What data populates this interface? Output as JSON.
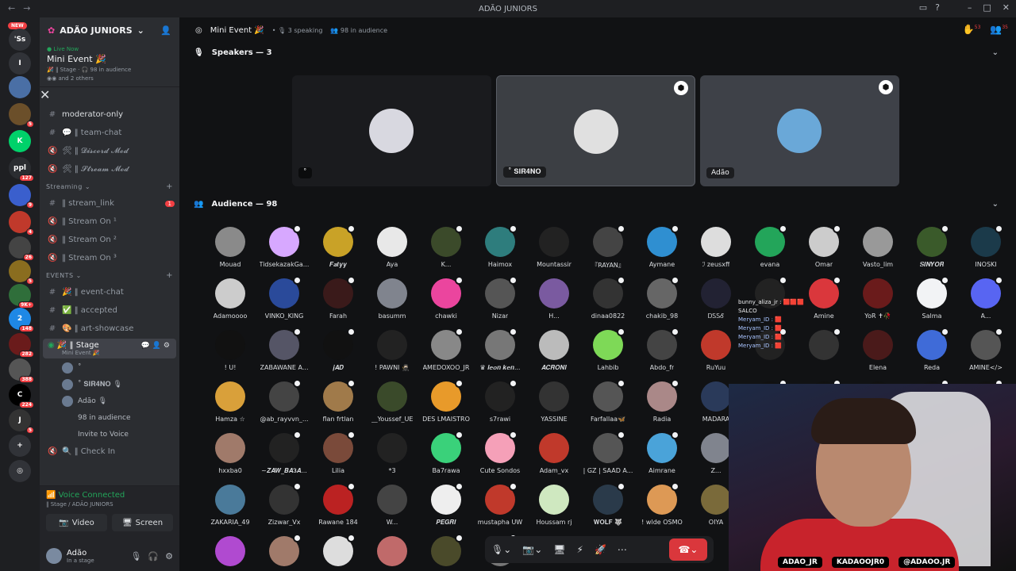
{
  "titlebar": {
    "title": "ADÃO JUNIORS"
  },
  "rail": {
    "new_badge": "NEW",
    "servers": [
      {
        "label": "'Ss",
        "color": "#313338",
        "count": ""
      },
      {
        "label": "I",
        "color": "#313338",
        "count": ""
      },
      {
        "label": "",
        "color": "#4a6fa5",
        "count": ""
      },
      {
        "label": "",
        "color": "#6b4f2a",
        "count": "5"
      },
      {
        "label": "K",
        "color": "#00d26a",
        "count": ""
      },
      {
        "label": "ppl",
        "color": "#2b2d31",
        "count": "127"
      },
      {
        "label": "",
        "color": "#3a5fcd",
        "count": "9"
      },
      {
        "label": "",
        "color": "#c0392b",
        "count": "4"
      },
      {
        "label": "",
        "color": "#444",
        "count": "26"
      },
      {
        "label": "",
        "color": "#8a6d1f",
        "count": "5"
      },
      {
        "label": "",
        "color": "#2f6e3a",
        "count": "9K+"
      },
      {
        "label": "2",
        "color": "#1e88e5",
        "count": "148"
      },
      {
        "label": "",
        "color": "#6a1b1b",
        "count": "282"
      },
      {
        "label": "",
        "color": "#555",
        "count": "388"
      },
      {
        "label": "C",
        "color": "#000",
        "count": "224"
      },
      {
        "label": "J",
        "color": "#333",
        "count": "5"
      },
      {
        "label": "+",
        "color": "#313338",
        "count": ""
      },
      {
        "label": "◎",
        "color": "#313338",
        "count": ""
      }
    ]
  },
  "sidebar": {
    "guild_name": "ADÃO JUNIORS",
    "live": {
      "tag": "Live Now",
      "title": "Mini Event 🎉",
      "meta": "🎉 ‖ Stage · 🎧 98 in audience",
      "others": "and 2 others"
    },
    "channels_top": [
      {
        "name": "moderator-only",
        "prefix": "#",
        "bright": true
      },
      {
        "name": "💬 ‖ team-chat",
        "prefix": "#",
        "bright": false
      },
      {
        "name": "🛠 ‖ 𝓓𝓲𝓼𝓬𝓸𝓻𝓭 𝓜𝓸𝓭",
        "prefix": "🔇",
        "bright": false
      },
      {
        "name": "🛠 ‖ 𝓢𝓽𝓻𝓮𝓪𝓶 𝓜𝓸𝓭",
        "prefix": "🔇",
        "bright": false
      }
    ],
    "cat_streaming": "Streaming",
    "channels_streaming": [
      {
        "name": "‖ stream_link",
        "prefix": "#",
        "badge": "1"
      },
      {
        "name": "‖ Stream On ¹",
        "prefix": "🔇",
        "badge": ""
      },
      {
        "name": "‖ Stream On ²",
        "prefix": "🔇",
        "badge": ""
      },
      {
        "name": "‖ Stream On ³",
        "prefix": "🔇",
        "badge": ""
      }
    ],
    "cat_events": "EVENTS",
    "channels_events": [
      {
        "name": "🎉 ‖ event-chat",
        "prefix": "#"
      },
      {
        "name": "✅ ‖ accepted",
        "prefix": "#"
      },
      {
        "name": "🎨 ‖ art-showcase",
        "prefix": "#"
      }
    ],
    "stage": {
      "name": "🎉 ‖ Stage",
      "sub": "Mini Event 🎉"
    },
    "members": [
      {
        "name": "˚"
      },
      {
        "name": "˚ 𝐒𝐈𝐑𝟒𝐍𝐎  🎙"
      },
      {
        "name": "Adão  🎙"
      },
      {
        "name": "98 in audience"
      },
      {
        "name": "Invite to Voice"
      }
    ],
    "check_in": "🔍 ‖ Check In",
    "voice": {
      "status": "Voice Connected",
      "location": "‖ Stage / ADÃO JUNIORS",
      "video_label": "Video",
      "screen_label": "Screen"
    },
    "user": {
      "name": "Adão",
      "status": "In a stage"
    }
  },
  "main": {
    "topbar": {
      "title": "Mini Event 🎉",
      "speaking": "3 speaking",
      "audience": "98 in audience",
      "inbox_count": "53",
      "notif_count": "35"
    },
    "speakers_header": "Speakers — 3",
    "speakers": [
      {
        "label": "˚",
        "bg": "#1a1b1e"
      },
      {
        "label": "˚ 𝐒𝐈𝐑𝟒𝐍𝐎",
        "bg": "#3c3f44"
      },
      {
        "label": "Adão",
        "bg": "#3e4148"
      }
    ],
    "audience_header": "Audience — 98",
    "audience": [
      {
        "name": "Mouad",
        "c": "#8a8a8a"
      },
      {
        "name": "TidsekazakGa...",
        "c": "#d7a8ff"
      },
      {
        "name": "𝑭𝒂𝒕𝒚𝒚",
        "c": "#c9a227"
      },
      {
        "name": "Aya",
        "c": "#e8e8e8"
      },
      {
        "name": "K...",
        "c": "#3b4a2a"
      },
      {
        "name": "Haimox",
        "c": "#2e7d7d"
      },
      {
        "name": "Mountassir",
        "c": "#222"
      },
      {
        "name": "『RAYAN』",
        "c": "#444"
      },
      {
        "name": "Aymane",
        "c": "#2f8fd1"
      },
      {
        "name": "ℐ zeusxff",
        "c": "#ddd"
      },
      {
        "name": "evana",
        "c": "#23a55a"
      },
      {
        "name": "Omar",
        "c": "#ccc"
      },
      {
        "name": "Vasto_lim",
        "c": "#999"
      },
      {
        "name": "𝑺𝑰𝑵𝒀𝑶𝑹",
        "c": "#3a5a2a"
      },
      {
        "name": "INOSKI",
        "c": "#1b3a4a"
      },
      {
        "name": "Adamoooo",
        "c": "#ccc"
      },
      {
        "name": "VINKO_KING",
        "c": "#2a4a9a"
      },
      {
        "name": "Farah",
        "c": "#3a1a1a"
      },
      {
        "name": "basumm",
        "c": "#80848e"
      },
      {
        "name": "chawki",
        "c": "#eb459e"
      },
      {
        "name": "Nizar",
        "c": "#555"
      },
      {
        "name": "H...",
        "c": "#7a5aa0"
      },
      {
        "name": "dinaa0822",
        "c": "#333"
      },
      {
        "name": "chakib_98",
        "c": "#666"
      },
      {
        "name": "ᎠᏚᏚᎴ",
        "c": "#223"
      },
      {
        "name": "",
        "c": "#222"
      },
      {
        "name": "Amine",
        "c": "#da373c"
      },
      {
        "name": "YoR ✝🥀",
        "c": "#6a1b1b"
      },
      {
        "name": "Salma",
        "c": "#f2f3f5"
      },
      {
        "name": "A...",
        "c": "#5865f2"
      },
      {
        "name": "! U!",
        "c": "#111"
      },
      {
        "name": "ZABAWANE A...",
        "c": "#556"
      },
      {
        "name": "𝒋𝑨𝑫",
        "c": "#111"
      },
      {
        "name": "! PAWNI 🥷🏻",
        "c": "#222"
      },
      {
        "name": "AMEDOXOO_JR",
        "c": "#888"
      },
      {
        "name": "♛ 𝒍𝒆𝒐𝒏 𝒌𝒆𝒏...",
        "c": "#777"
      },
      {
        "name": "𝑨𝑪𝑹𝑶𝑵𝑰",
        "c": "#bbb"
      },
      {
        "name": "Lahbib",
        "c": "#7ed957"
      },
      {
        "name": "Abdo_fr",
        "c": "#444"
      },
      {
        "name": "RuYuu",
        "c": "#c0392b"
      },
      {
        "name": "",
        "c": "#222"
      },
      {
        "name": "",
        "c": "#333"
      },
      {
        "name": "Elena",
        "c": "#4a1a1a"
      },
      {
        "name": "Reda",
        "c": "#3f6bd8"
      },
      {
        "name": "AMINE</>",
        "c": "#555"
      },
      {
        "name": "Hamza ☆",
        "c": "#d9a03a"
      },
      {
        "name": "@ab_rayvvn_...",
        "c": "#444"
      },
      {
        "name": "flan frtlan",
        "c": "#a07a4a"
      },
      {
        "name": "__Youssef_UE",
        "c": "#3a4a2a"
      },
      {
        "name": "DES LMAISTRO",
        "c": "#e89a2a"
      },
      {
        "name": "s7rawi",
        "c": "#222"
      },
      {
        "name": "YASSINE",
        "c": "#333"
      },
      {
        "name": "Farfallaa🦋",
        "c": "#555"
      },
      {
        "name": "Radia",
        "c": "#a88"
      },
      {
        "name": "MADARA",
        "c": "#2a3a5a"
      },
      {
        "name": "",
        "c": "#111"
      },
      {
        "name": "",
        "c": "#111"
      },
      {
        "name": "",
        "c": "#111"
      },
      {
        "name": "",
        "c": "#111"
      },
      {
        "name": "",
        "c": "#111"
      },
      {
        "name": "hxxba0",
        "c": "#a07a6a"
      },
      {
        "name": "~𝒁𝑨𝑾_𝑩𝑨𝟑𝑨...",
        "c": "#222"
      },
      {
        "name": "Lilia",
        "c": "#7a4a3a"
      },
      {
        "name": "*3",
        "c": "#222"
      },
      {
        "name": "Ba7rawa",
        "c": "#3ad17a"
      },
      {
        "name": "Cute Sondos",
        "c": "#f5a0b8"
      },
      {
        "name": "Adam_vx",
        "c": "#c0392b"
      },
      {
        "name": "| GZ | SAAD A...",
        "c": "#555"
      },
      {
        "name": "Aimrane",
        "c": "#4aa3d9"
      },
      {
        "name": "Z...",
        "c": "#80848e"
      },
      {
        "name": "",
        "c": "#111"
      },
      {
        "name": "",
        "c": "#111"
      },
      {
        "name": "",
        "c": "#111"
      },
      {
        "name": "",
        "c": "#111"
      },
      {
        "name": "",
        "c": "#111"
      },
      {
        "name": "ZAKARIA_49",
        "c": "#4a7a9a"
      },
      {
        "name": "Zizwar_Vx",
        "c": "#333"
      },
      {
        "name": "Rawane 184",
        "c": "#b22"
      },
      {
        "name": "W...",
        "c": "#444"
      },
      {
        "name": "𝑷𝑬𝑮𝑹𝑰",
        "c": "#eee"
      },
      {
        "name": "mustapha UW",
        "c": "#c0392b"
      },
      {
        "name": "Houssam rj",
        "c": "#cfe8c0"
      },
      {
        "name": "𝐖𝐎𝐋𝐅 🐺",
        "c": "#2a3a4a"
      },
      {
        "name": "! wlde OSMO",
        "c": "#d95"
      },
      {
        "name": "OIYA",
        "c": "#7a6a3a"
      },
      {
        "name": "",
        "c": "#111"
      },
      {
        "name": "",
        "c": "#111"
      },
      {
        "name": "",
        "c": "#111"
      },
      {
        "name": "",
        "c": "#111"
      },
      {
        "name": "",
        "c": "#111"
      },
      {
        "name": "",
        "c": "#b04ad0"
      },
      {
        "name": "",
        "c": "#a07a6a"
      },
      {
        "name": "",
        "c": "#ddd"
      },
      {
        "name": "",
        "c": "#c06a6a"
      },
      {
        "name": "",
        "c": "#4a4a2a"
      },
      {
        "name": "",
        "c": "#777"
      }
    ]
  },
  "chat_overlay": [
    "bunny_aliza_jr : 🟥🟥🟥",
    "Meryam_ID : 🟥",
    "Meryam_ID : 🟥",
    "Meryam_ID : 🟥",
    "Meryam_ID : 🟥"
  ],
  "chat_overlay_user": "SALCO",
  "cam": {
    "socials": [
      "ADAO_JR",
      "KADAOOJR0",
      "@ADAOO.JR"
    ]
  }
}
